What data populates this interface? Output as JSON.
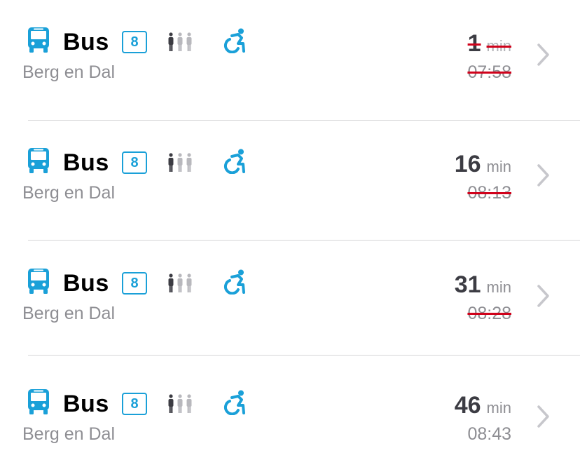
{
  "departures": [
    {
      "mode": "Bus",
      "line": "8",
      "destination": "Berg en Dal",
      "minutes": "1",
      "unit": "min",
      "time": "07:58",
      "minutes_struck": true,
      "time_struck": true
    },
    {
      "mode": "Bus",
      "line": "8",
      "destination": "Berg en Dal",
      "minutes": "16",
      "unit": "min",
      "time": "08:13",
      "minutes_struck": false,
      "time_struck": true
    },
    {
      "mode": "Bus",
      "line": "8",
      "destination": "Berg en Dal",
      "minutes": "31",
      "unit": "min",
      "time": "08:28",
      "minutes_struck": false,
      "time_struck": true
    },
    {
      "mode": "Bus",
      "line": "8",
      "destination": "Berg en Dal",
      "minutes": "46",
      "unit": "min",
      "time": "08:43",
      "minutes_struck": false,
      "time_struck": false
    }
  ],
  "icons": {
    "mode": "bus-icon",
    "occupancy": "occupancy-icon",
    "accessibility": "wheelchair-icon",
    "chevron": "chevron-right-icon"
  },
  "colors": {
    "accent": "#1aa0d8",
    "strike": "#d0021b",
    "secondary_text": "#8e8e93",
    "separator": "#d6d6d8"
  }
}
